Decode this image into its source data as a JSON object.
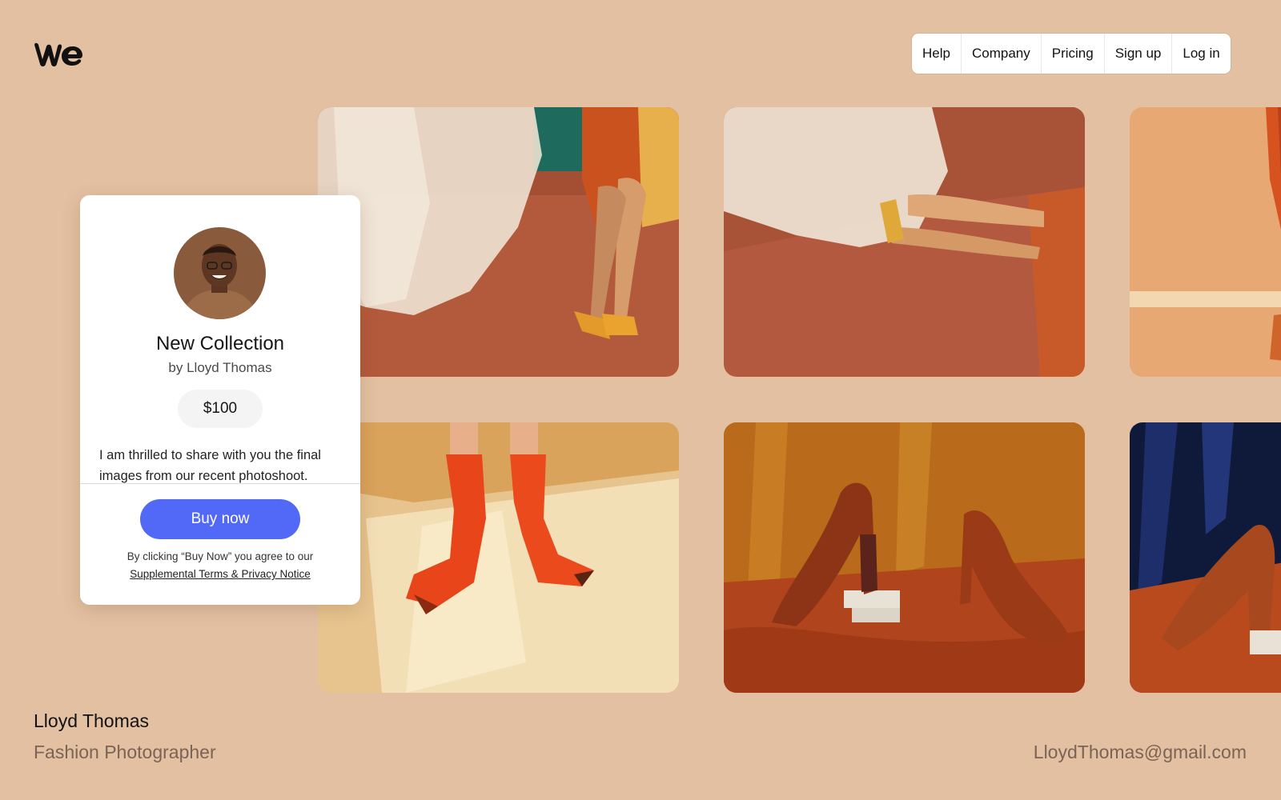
{
  "brand": {
    "logo_icon": "we-logo-icon"
  },
  "nav": {
    "items": [
      "Help",
      "Company",
      "Pricing",
      "Sign up",
      "Log in"
    ]
  },
  "card": {
    "title": "New Collection",
    "author": "by Lloyd Thomas",
    "price": "$100",
    "description": "I am thrilled to share with you the final images from our recent photoshoot.",
    "buy_label": "Buy now",
    "agree_text": "By clicking “Buy Now” you agree to our",
    "terms_link": "Supplemental Terms & Privacy Notice",
    "accent_color": "#5269f8"
  },
  "footer": {
    "name": "Lloyd Thomas",
    "role": "Fashion Photographer",
    "email": "LloydThomas@gmail.com"
  },
  "gallery": {
    "photos": [
      "photo-curtain-yellow-heels",
      "photo-reclining-sheer-fabric",
      "photo-orange-skirt-cropped",
      "photo-orange-satin-boots",
      "photo-brown-heels-on-fabric",
      "photo-brown-heel-blue-velvet"
    ]
  },
  "colors": {
    "background": "#e3c0a2",
    "button": "#5269f8"
  }
}
